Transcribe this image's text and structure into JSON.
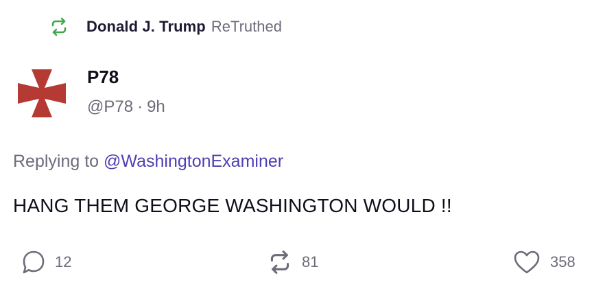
{
  "retruth": {
    "icon": "retruth-icon",
    "name": "Donald J. Trump",
    "verb": "ReTruthed",
    "color": "#3ea84b"
  },
  "author": {
    "avatar": "red-cross-avatar",
    "name": "P78",
    "handle": "@P78",
    "separator": "·",
    "time": "9h"
  },
  "reply": {
    "prefix": "Replying to",
    "handle": "@WashingtonExaminer",
    "handle_color": "#4d3fb3"
  },
  "post": {
    "text": "HANG THEM GEORGE WASHINGTON WOULD !!"
  },
  "actions": {
    "replies": {
      "icon": "reply-icon",
      "count": "12"
    },
    "retruths": {
      "icon": "retruth-icon",
      "count": "81"
    },
    "likes": {
      "icon": "heart-icon",
      "count": "358"
    }
  },
  "colors": {
    "muted": "#6b6b7a",
    "avatar_red": "#b53a33"
  }
}
